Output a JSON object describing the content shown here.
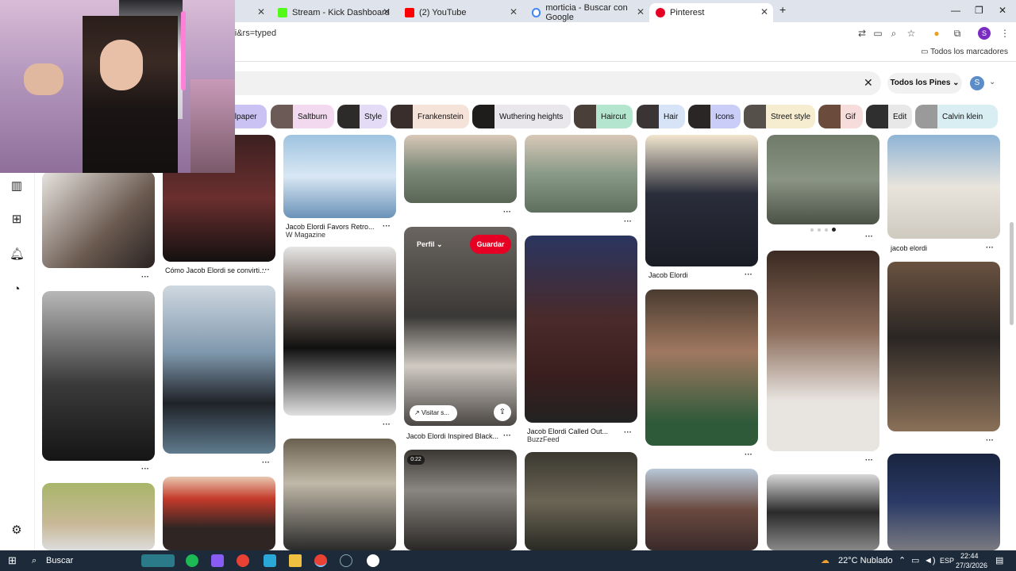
{
  "browser": {
    "tabs": [
      {
        "title": "",
        "color": "#dfe3eb"
      },
      {
        "title": "Stream - Kick Dashboard",
        "color": "#53fc18"
      },
      {
        "title": "(2) YouTube",
        "color": "#ff0000"
      },
      {
        "title": "morticia - Buscar con Google",
        "color": "#4285f4"
      },
      {
        "title": "Pinterest",
        "color": "#e60023"
      }
    ],
    "new_tab": "+",
    "url": "rdi&rs=typed",
    "bookmarks_all": "Todos los marcadores",
    "profile_initial": "S"
  },
  "pinterest": {
    "filter_label": "Todos los Pines",
    "avatar": "S",
    "chips": [
      {
        "label": "allpaper",
        "bg": "#c9c2f2"
      },
      {
        "label": "Saltburn",
        "bg": "#f3d9ef"
      },
      {
        "label": "Style",
        "bg": "#e4dcf6"
      },
      {
        "label": "Frankenstein",
        "bg": "#f5e2d9"
      },
      {
        "label": "Wuthering heights",
        "bg": "#e9e6ec"
      },
      {
        "label": "Haircut",
        "bg": "#b4e6cf"
      },
      {
        "label": "Hair",
        "bg": "#d7e3f6"
      },
      {
        "label": "Icons",
        "bg": "#c9cdf7"
      },
      {
        "label": "Street style",
        "bg": "#f6ecd0"
      },
      {
        "label": "Gif",
        "bg": "#f7dcdc"
      },
      {
        "label": "Edit",
        "bg": "#e8e8e8"
      },
      {
        "label": "Calvin klein",
        "bg": "#d8eef3"
      }
    ],
    "captions": {
      "c1": "Jacob Elordi Favors Retro...",
      "c1_sub": "W Magazine",
      "c2": "Cómo Jacob Elordi se convirti...",
      "c3": "Jacob Elordi",
      "c4": "jacob elordi",
      "c5": "Jacob Elordi Inspired Black...",
      "c6": "Jacob Elordi Called Out...",
      "c6_sub": "BuzzFeed"
    },
    "hover": {
      "profile": "Perfil",
      "save": "Guardar",
      "visit": "Visitar s..."
    },
    "video_badge": "0:22",
    "more": "···"
  },
  "taskbar": {
    "search": "Buscar",
    "weather": "22°C  Nublado",
    "lang": "ESP",
    "time": "22:44",
    "date": "27/3/2026"
  }
}
